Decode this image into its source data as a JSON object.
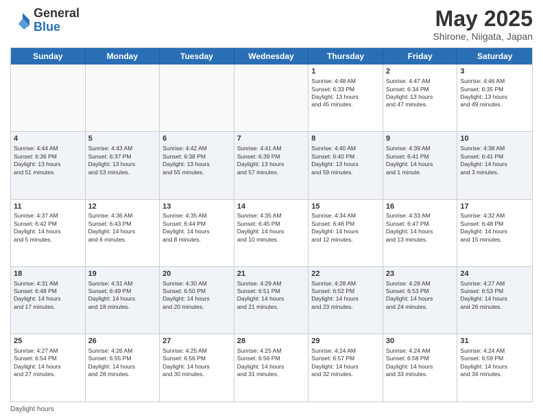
{
  "header": {
    "logo_general": "General",
    "logo_blue": "Blue",
    "month_title": "May 2025",
    "location": "Shirone, Niigata, Japan"
  },
  "footer": {
    "label": "Daylight hours"
  },
  "weekdays": [
    "Sunday",
    "Monday",
    "Tuesday",
    "Wednesday",
    "Thursday",
    "Friday",
    "Saturday"
  ],
  "rows": [
    {
      "alt": false,
      "cells": [
        {
          "empty": true,
          "day": "",
          "lines": []
        },
        {
          "empty": true,
          "day": "",
          "lines": []
        },
        {
          "empty": true,
          "day": "",
          "lines": []
        },
        {
          "empty": true,
          "day": "",
          "lines": []
        },
        {
          "empty": false,
          "day": "1",
          "lines": [
            "Sunrise: 4:48 AM",
            "Sunset: 6:33 PM",
            "Daylight: 13 hours",
            "and 45 minutes."
          ]
        },
        {
          "empty": false,
          "day": "2",
          "lines": [
            "Sunrise: 4:47 AM",
            "Sunset: 6:34 PM",
            "Daylight: 13 hours",
            "and 47 minutes."
          ]
        },
        {
          "empty": false,
          "day": "3",
          "lines": [
            "Sunrise: 4:46 AM",
            "Sunset: 6:35 PM",
            "Daylight: 13 hours",
            "and 49 minutes."
          ]
        }
      ]
    },
    {
      "alt": true,
      "cells": [
        {
          "empty": false,
          "day": "4",
          "lines": [
            "Sunrise: 4:44 AM",
            "Sunset: 6:36 PM",
            "Daylight: 13 hours",
            "and 51 minutes."
          ]
        },
        {
          "empty": false,
          "day": "5",
          "lines": [
            "Sunrise: 4:43 AM",
            "Sunset: 6:37 PM",
            "Daylight: 13 hours",
            "and 53 minutes."
          ]
        },
        {
          "empty": false,
          "day": "6",
          "lines": [
            "Sunrise: 4:42 AM",
            "Sunset: 6:38 PM",
            "Daylight: 13 hours",
            "and 55 minutes."
          ]
        },
        {
          "empty": false,
          "day": "7",
          "lines": [
            "Sunrise: 4:41 AM",
            "Sunset: 6:39 PM",
            "Daylight: 13 hours",
            "and 57 minutes."
          ]
        },
        {
          "empty": false,
          "day": "8",
          "lines": [
            "Sunrise: 4:40 AM",
            "Sunset: 6:40 PM",
            "Daylight: 13 hours",
            "and 59 minutes."
          ]
        },
        {
          "empty": false,
          "day": "9",
          "lines": [
            "Sunrise: 4:39 AM",
            "Sunset: 6:41 PM",
            "Daylight: 14 hours",
            "and 1 minute."
          ]
        },
        {
          "empty": false,
          "day": "10",
          "lines": [
            "Sunrise: 4:38 AM",
            "Sunset: 6:41 PM",
            "Daylight: 14 hours",
            "and 3 minutes."
          ]
        }
      ]
    },
    {
      "alt": false,
      "cells": [
        {
          "empty": false,
          "day": "11",
          "lines": [
            "Sunrise: 4:37 AM",
            "Sunset: 6:42 PM",
            "Daylight: 14 hours",
            "and 5 minutes."
          ]
        },
        {
          "empty": false,
          "day": "12",
          "lines": [
            "Sunrise: 4:36 AM",
            "Sunset: 6:43 PM",
            "Daylight: 14 hours",
            "and 6 minutes."
          ]
        },
        {
          "empty": false,
          "day": "13",
          "lines": [
            "Sunrise: 4:35 AM",
            "Sunset: 6:44 PM",
            "Daylight: 14 hours",
            "and 8 minutes."
          ]
        },
        {
          "empty": false,
          "day": "14",
          "lines": [
            "Sunrise: 4:35 AM",
            "Sunset: 6:45 PM",
            "Daylight: 14 hours",
            "and 10 minutes."
          ]
        },
        {
          "empty": false,
          "day": "15",
          "lines": [
            "Sunrise: 4:34 AM",
            "Sunset: 6:46 PM",
            "Daylight: 14 hours",
            "and 12 minutes."
          ]
        },
        {
          "empty": false,
          "day": "16",
          "lines": [
            "Sunrise: 4:33 AM",
            "Sunset: 6:47 PM",
            "Daylight: 14 hours",
            "and 13 minutes."
          ]
        },
        {
          "empty": false,
          "day": "17",
          "lines": [
            "Sunrise: 4:32 AM",
            "Sunset: 6:48 PM",
            "Daylight: 14 hours",
            "and 15 minutes."
          ]
        }
      ]
    },
    {
      "alt": true,
      "cells": [
        {
          "empty": false,
          "day": "18",
          "lines": [
            "Sunrise: 4:31 AM",
            "Sunset: 6:48 PM",
            "Daylight: 14 hours",
            "and 17 minutes."
          ]
        },
        {
          "empty": false,
          "day": "19",
          "lines": [
            "Sunrise: 4:31 AM",
            "Sunset: 6:49 PM",
            "Daylight: 14 hours",
            "and 18 minutes."
          ]
        },
        {
          "empty": false,
          "day": "20",
          "lines": [
            "Sunrise: 4:30 AM",
            "Sunset: 6:50 PM",
            "Daylight: 14 hours",
            "and 20 minutes."
          ]
        },
        {
          "empty": false,
          "day": "21",
          "lines": [
            "Sunrise: 4:29 AM",
            "Sunset: 6:51 PM",
            "Daylight: 14 hours",
            "and 21 minutes."
          ]
        },
        {
          "empty": false,
          "day": "22",
          "lines": [
            "Sunrise: 4:28 AM",
            "Sunset: 6:52 PM",
            "Daylight: 14 hours",
            "and 23 minutes."
          ]
        },
        {
          "empty": false,
          "day": "23",
          "lines": [
            "Sunrise: 4:28 AM",
            "Sunset: 6:53 PM",
            "Daylight: 14 hours",
            "and 24 minutes."
          ]
        },
        {
          "empty": false,
          "day": "24",
          "lines": [
            "Sunrise: 4:27 AM",
            "Sunset: 6:53 PM",
            "Daylight: 14 hours",
            "and 26 minutes."
          ]
        }
      ]
    },
    {
      "alt": false,
      "cells": [
        {
          "empty": false,
          "day": "25",
          "lines": [
            "Sunrise: 4:27 AM",
            "Sunset: 6:54 PM",
            "Daylight: 14 hours",
            "and 27 minutes."
          ]
        },
        {
          "empty": false,
          "day": "26",
          "lines": [
            "Sunrise: 4:26 AM",
            "Sunset: 6:55 PM",
            "Daylight: 14 hours",
            "and 28 minutes."
          ]
        },
        {
          "empty": false,
          "day": "27",
          "lines": [
            "Sunrise: 4:25 AM",
            "Sunset: 6:56 PM",
            "Daylight: 14 hours",
            "and 30 minutes."
          ]
        },
        {
          "empty": false,
          "day": "28",
          "lines": [
            "Sunrise: 4:25 AM",
            "Sunset: 6:56 PM",
            "Daylight: 14 hours",
            "and 31 minutes."
          ]
        },
        {
          "empty": false,
          "day": "29",
          "lines": [
            "Sunrise: 4:24 AM",
            "Sunset: 6:57 PM",
            "Daylight: 14 hours",
            "and 32 minutes."
          ]
        },
        {
          "empty": false,
          "day": "30",
          "lines": [
            "Sunrise: 4:24 AM",
            "Sunset: 6:58 PM",
            "Daylight: 14 hours",
            "and 33 minutes."
          ]
        },
        {
          "empty": false,
          "day": "31",
          "lines": [
            "Sunrise: 4:24 AM",
            "Sunset: 6:59 PM",
            "Daylight: 14 hours",
            "and 34 minutes."
          ]
        }
      ]
    }
  ]
}
